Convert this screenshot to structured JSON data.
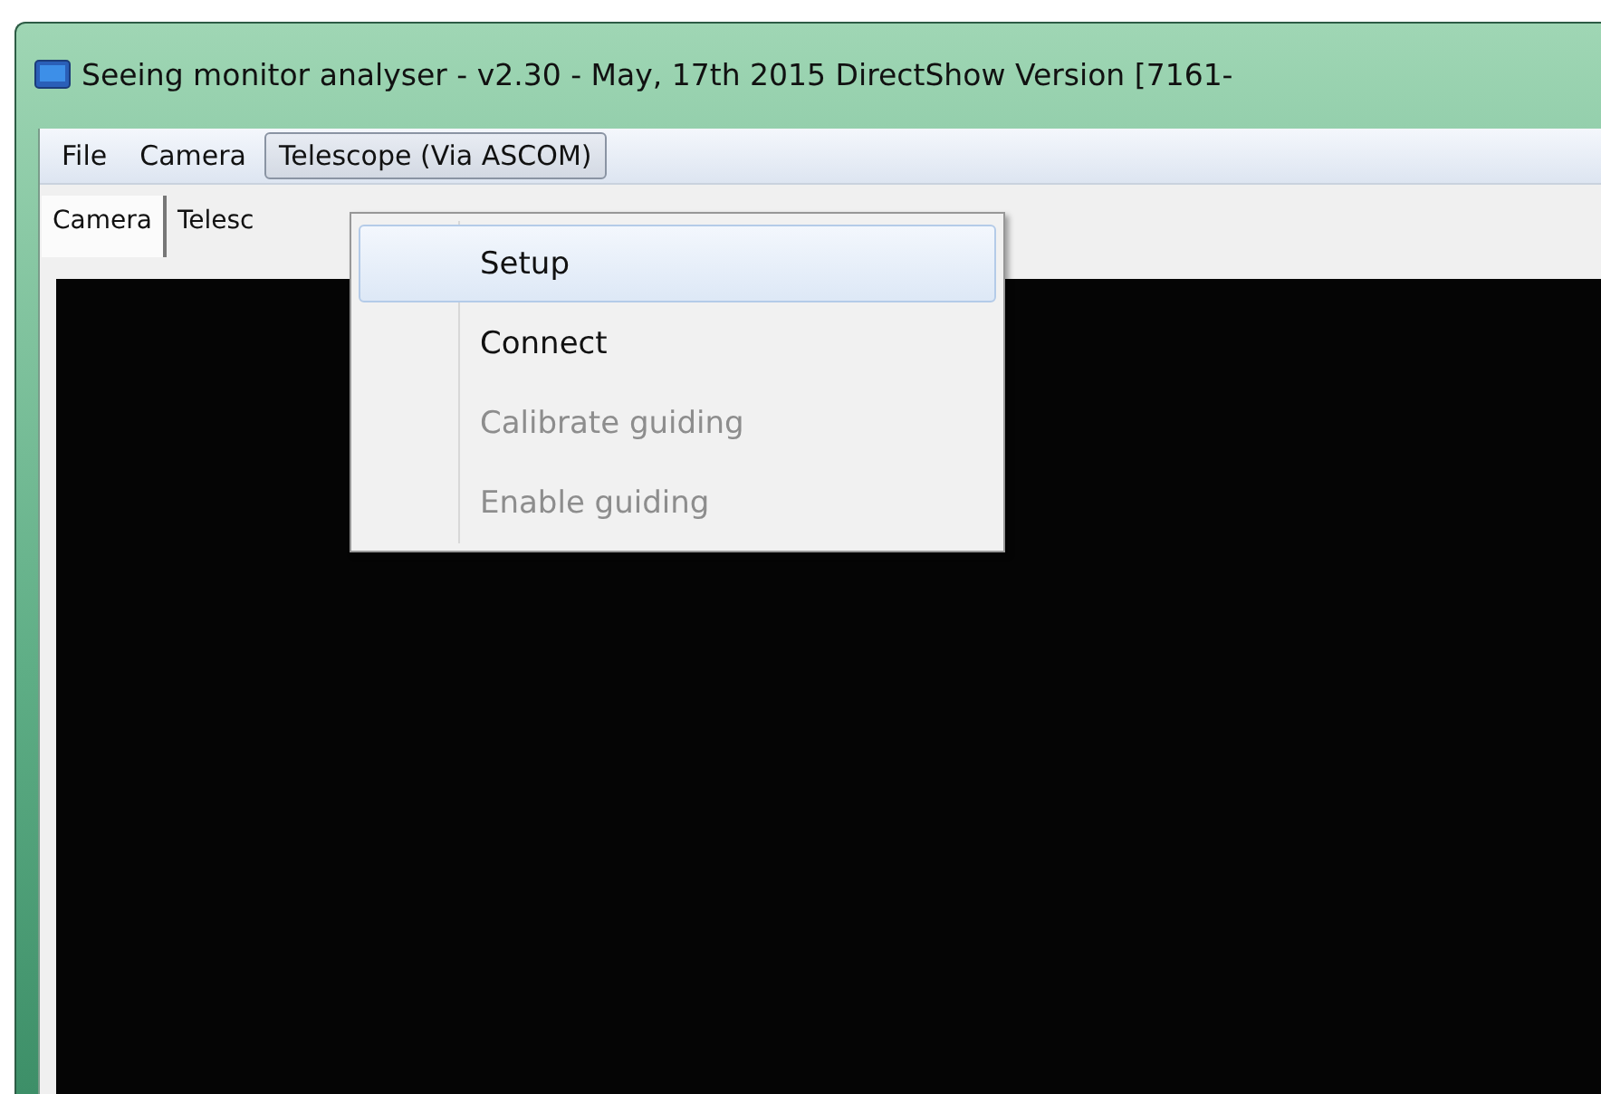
{
  "window": {
    "title": "Seeing monitor analyser - v2.30 - May, 17th 2015 DirectShow Version  [7161-"
  },
  "menu_bar": [
    {
      "label": "File",
      "selected": false
    },
    {
      "label": "Camera",
      "selected": false
    },
    {
      "label": "Telescope (Via ASCOM)",
      "selected": true
    }
  ],
  "tabs": [
    {
      "label": "Camera",
      "selected": true
    },
    {
      "label": "Telesc",
      "selected": false
    }
  ],
  "dropdown": [
    {
      "label": "Setup",
      "highlighted": true,
      "disabled": false
    },
    {
      "label": "Connect",
      "highlighted": false,
      "disabled": false
    },
    {
      "label": "Calibrate guiding",
      "highlighted": false,
      "disabled": true
    },
    {
      "label": "Enable guiding",
      "highlighted": false,
      "disabled": true
    }
  ]
}
